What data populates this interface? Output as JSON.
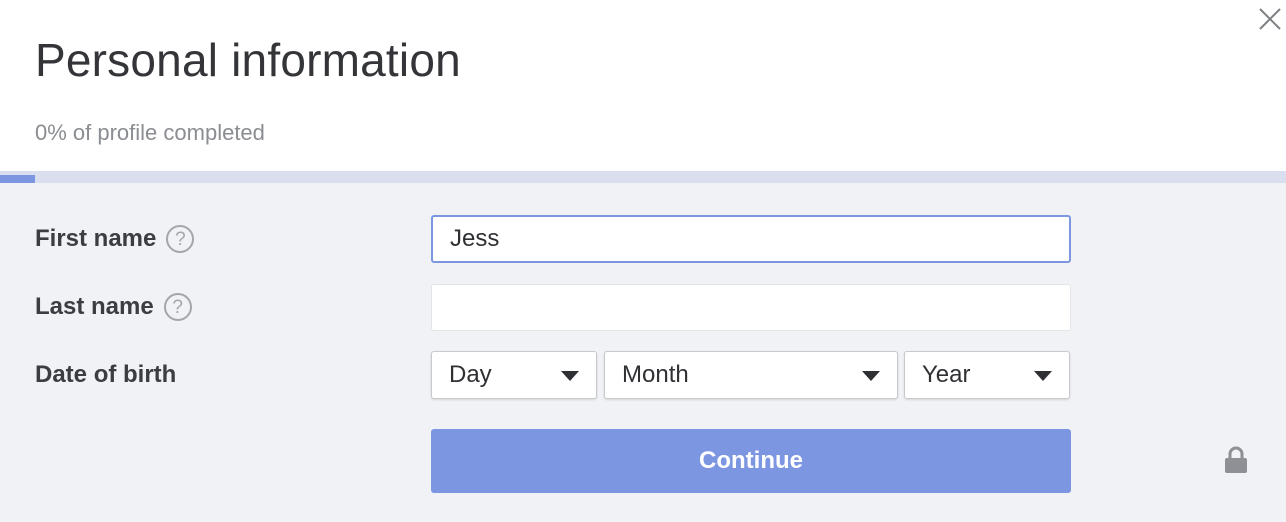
{
  "header": {
    "title": "Personal information",
    "progress_text": "0% of profile completed",
    "progress_fraction": 0.027
  },
  "form": {
    "first_name": {
      "label": "First name",
      "help": "?",
      "value": "Jess"
    },
    "last_name": {
      "label": "Last name",
      "help": "?",
      "value": ""
    },
    "date_of_birth": {
      "label": "Date of birth",
      "day": "Day",
      "month": "Month",
      "year": "Year"
    },
    "continue_label": "Continue"
  },
  "icons": {
    "close": "close-icon",
    "help": "question-circle-icon",
    "caret": "caret-down-icon",
    "lock": "lock-icon"
  },
  "colors": {
    "accent": "#7c96e2",
    "track": "#d9dfef",
    "form_background": "#f0f2f5"
  }
}
